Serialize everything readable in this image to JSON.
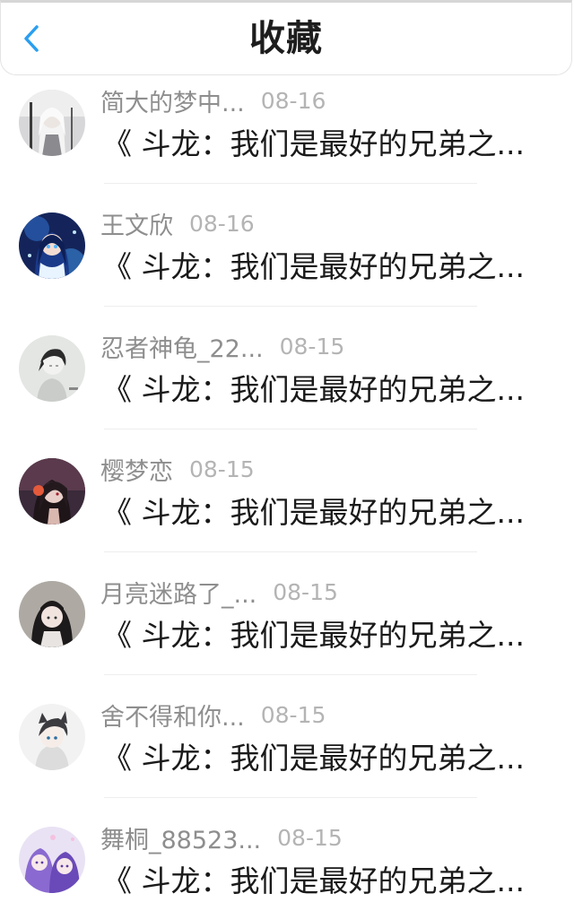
{
  "header": {
    "title": "收藏",
    "back_icon": "chevron-left-icon",
    "accent_color": "#2a9ff0"
  },
  "items": [
    {
      "username": "简大的梦中...",
      "date": "08-16",
      "snippet": "《 斗龙：我们是最好的兄弟之...",
      "avatar": "avatar-white-haired-girl"
    },
    {
      "username": "王文欣",
      "date": "08-16",
      "snippet": "《 斗龙：我们是最好的兄弟之...",
      "avatar": "avatar-blue-anime-girl"
    },
    {
      "username": "忍者神龟_22...",
      "date": "08-15",
      "snippet": "《 斗龙：我们是最好的兄弟之...",
      "avatar": "avatar-sketch-boy"
    },
    {
      "username": "樱梦恋",
      "date": "08-15",
      "snippet": "《 斗龙：我们是最好的兄弟之...",
      "avatar": "avatar-dark-anime-girl"
    },
    {
      "username": "月亮迷路了_...",
      "date": "08-15",
      "snippet": "《 斗龙：我们是最好的兄弟之...",
      "avatar": "avatar-photo-girl"
    },
    {
      "username": "舍不得和你...",
      "date": "08-15",
      "snippet": "《 斗龙：我们是最好的兄弟之...",
      "avatar": "avatar-cat-ear-boy"
    },
    {
      "username": "舞桐_88523...",
      "date": "08-15",
      "snippet": "《 斗龙：我们是最好的兄弟之...",
      "avatar": "avatar-purple-anime-pair"
    }
  ]
}
